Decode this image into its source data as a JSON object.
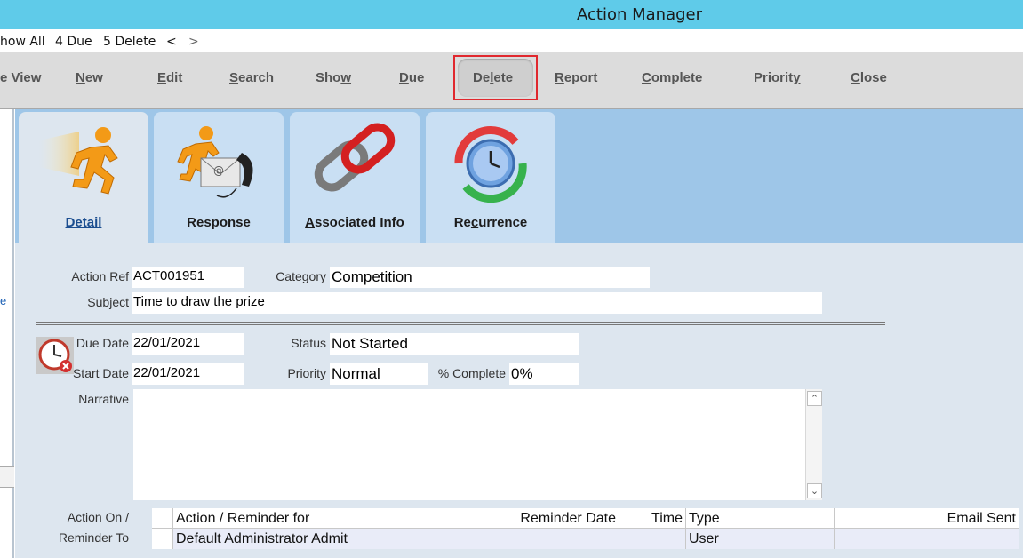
{
  "window": {
    "title": "Action Manager"
  },
  "subnav": {
    "show_all": "how All",
    "due": "4 Due",
    "delete": "5 Delete",
    "prev": "<",
    "next": ">"
  },
  "toolbar": {
    "items": [
      {
        "pre": "e View",
        "u": "",
        "post": ""
      },
      {
        "pre": "",
        "u": "N",
        "post": "ew"
      },
      {
        "pre": "",
        "u": "E",
        "post": "dit"
      },
      {
        "pre": "",
        "u": "S",
        "post": "earch"
      },
      {
        "pre": "Sho",
        "u": "w",
        "post": ""
      },
      {
        "pre": "",
        "u": "D",
        "post": "ue"
      },
      {
        "pre": "De",
        "u": "l",
        "post": "ete"
      },
      {
        "pre": "",
        "u": "R",
        "post": "eport"
      },
      {
        "pre": "",
        "u": "C",
        "post": "omplete"
      },
      {
        "pre": "Priorit",
        "u": "y",
        "post": ""
      },
      {
        "pre": "",
        "u": "C",
        "post": "lose"
      }
    ]
  },
  "left_panel": {
    "label": "e"
  },
  "tabs": [
    {
      "pre": "",
      "u": "D",
      "post": "etail"
    },
    {
      "pre": "Response",
      "u": "",
      "post": ""
    },
    {
      "pre": "",
      "u": "A",
      "post": "ssociated Info"
    },
    {
      "pre": "Re",
      "u": "c",
      "post": "urrence"
    }
  ],
  "form": {
    "action_ref_label": "Action Ref",
    "action_ref": "ACT001951",
    "category_label": "Category",
    "category": "Competition",
    "subject_label": "Subject",
    "subject": "Time to draw the prize",
    "due_date_label": "Due Date",
    "due_date": "22/01/2021",
    "status_label": "Status",
    "status": "Not Started",
    "start_date_label": "Start Date",
    "start_date": "22/01/2021",
    "priority_label": "Priority",
    "priority": "Normal",
    "complete_label": "% Complete",
    "complete": "0%",
    "narrative_label": "Narrative",
    "narrative": "",
    "action_on_label_1": "Action On /",
    "action_on_label_2": "Reminder To"
  },
  "grid": {
    "columns": [
      "Action / Reminder for",
      "Reminder Date",
      "Time",
      "Type",
      "Email Sent"
    ],
    "rows": [
      [
        "Default Administrator Admit",
        "",
        "",
        "User",
        ""
      ]
    ]
  },
  "colors": {
    "titlebar": "#5fcbe9",
    "tabstrip": "#9ec6e8",
    "highlight": "#e0282e"
  }
}
